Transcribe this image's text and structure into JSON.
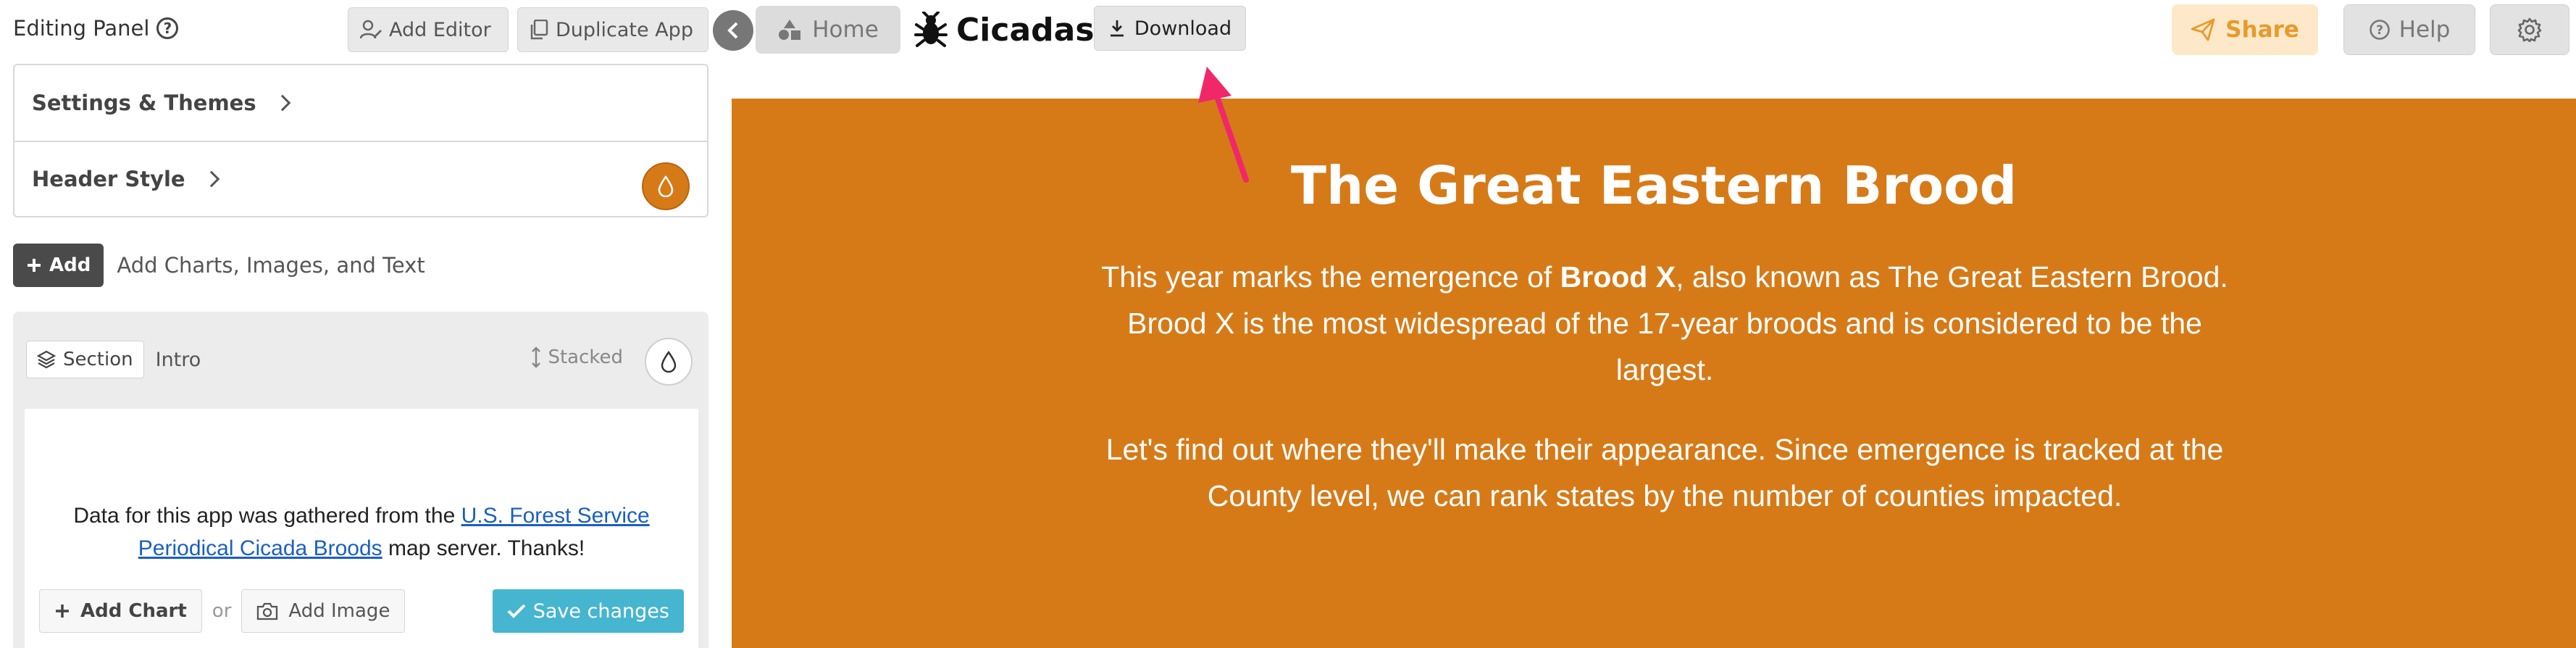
{
  "editor": {
    "title": "Editing Panel",
    "add_editor_label": "Add Editor",
    "duplicate_app_label": "Duplicate App",
    "settings_items": [
      {
        "label": "Settings & Themes"
      },
      {
        "label": "Header Style"
      }
    ],
    "add_label": "Add",
    "add_hint": "Add Charts, Images, and Text",
    "section": {
      "chip_label": "Section",
      "name": "Intro",
      "layout_label": "Stacked",
      "credit_before": "Data for this app was gathered from the ",
      "credit_link": "U.S. Forest Service Periodical Cicada Broods",
      "credit_after": " map server. Thanks!",
      "add_chart_label": "Add Chart",
      "or_label": "or",
      "add_image_label": "Add Image",
      "save_label": "Save changes"
    }
  },
  "topbar": {
    "home_label": "Home",
    "app_name": "Cicadas",
    "download_label": "Download",
    "share_label": "Share",
    "help_label": "Help"
  },
  "preview": {
    "title": "The Great Eastern Brood",
    "p1_before": "This year marks the emergence of ",
    "p1_bold": "Brood X",
    "p1_after": ", also known as The Great Eastern Brood. Brood X is the most widespread of the 17-year broods and is considered to be the largest.",
    "p2": "Let's find out where they'll make their appearance. Since emergence is tracked at the County level, we can rank states by the number of counties impacted."
  },
  "colors": {
    "accent_orange": "#d67a18",
    "save_blue": "#45b5d0",
    "share_text": "#e89a2c",
    "annotation_arrow": "#f0286a"
  },
  "icons": [
    "help-circle-icon",
    "user-edit-icon",
    "copy-icon",
    "chevron-right-icon",
    "droplet-icon",
    "plus-icon",
    "layers-icon",
    "vertical-arrows-icon",
    "check-icon",
    "camera-icon",
    "chevron-left-icon",
    "shapes-icon",
    "bug-icon",
    "download-icon",
    "send-icon",
    "gear-icon"
  ]
}
